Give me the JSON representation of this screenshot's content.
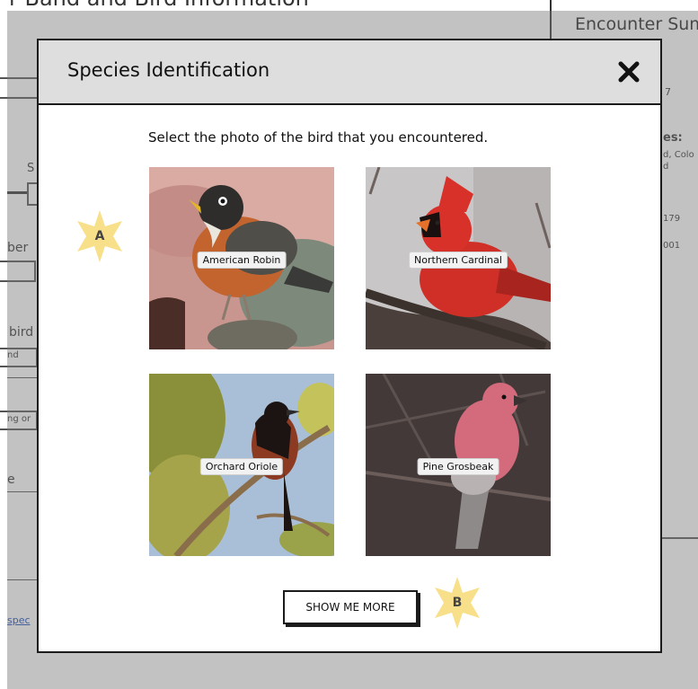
{
  "background": {
    "page_title": "r Band and Bird Information",
    "encounter_title": "Encounter Sum",
    "fragments": {
      "s": "S",
      "ber": "ber",
      "bird": "bird",
      "nd": "nd",
      "ng_or": "ng or",
      "e": "e",
      "spec_link": "spec",
      "f7": "7",
      "es": "es:",
      "colo": "d, Colo",
      "d": "d",
      "n179": "179",
      "n001": "001"
    }
  },
  "modal": {
    "title": "Species Identification",
    "instruction": "Select the photo of the bird that you encountered.",
    "show_more_label": "SHOW ME MORE",
    "birds": [
      {
        "label": "American Robin"
      },
      {
        "label": "Northern Cardinal"
      },
      {
        "label": "Orchard Oriole"
      },
      {
        "label": "Pine Grosbeak"
      }
    ]
  },
  "markers": {
    "a": "A",
    "b": "B"
  },
  "colors": {
    "marker_fill": "#f8df8a",
    "header_bg": "#dedede",
    "border": "#1b1b1b"
  }
}
